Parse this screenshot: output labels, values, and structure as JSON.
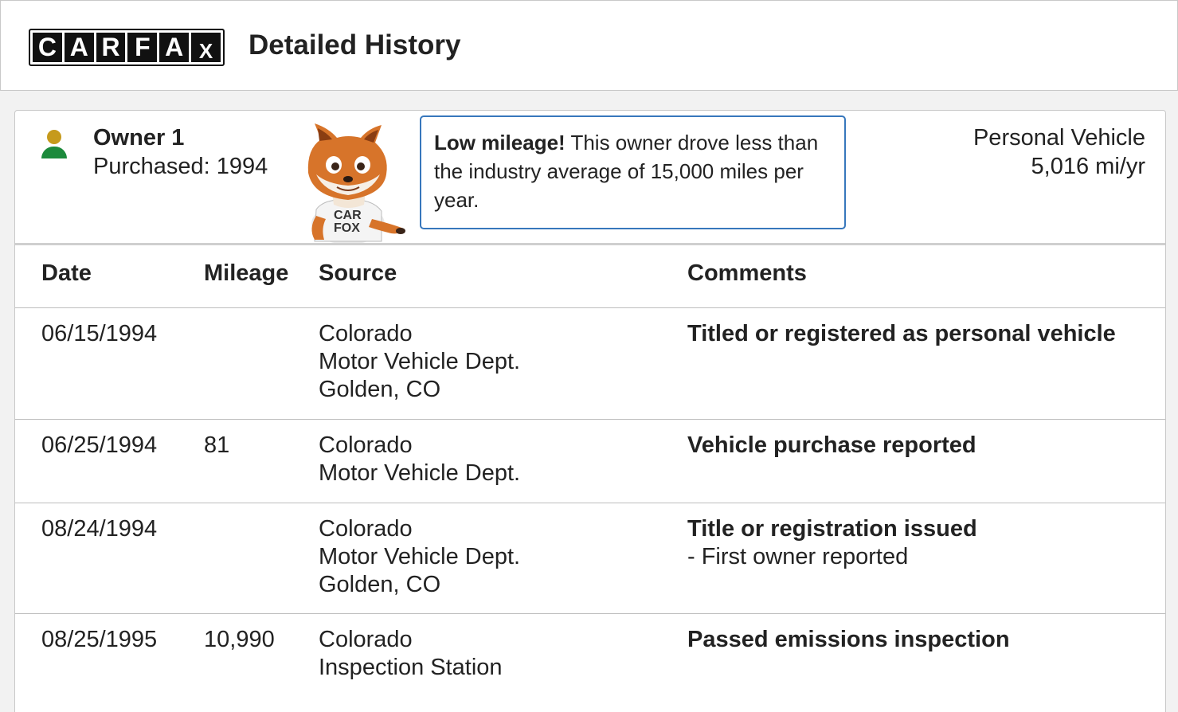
{
  "header": {
    "logo_letters": [
      "C",
      "A",
      "R",
      "F",
      "A",
      "X"
    ],
    "title": "Detailed History"
  },
  "owner": {
    "title": "Owner 1",
    "purchased": "Purchased: 1994",
    "mascot_shirt_text": "CAR FOX",
    "callout_bold": "Low mileage!",
    "callout_text": " This owner drove less than the industry average of 15,000 miles per year.",
    "vehicle_type": "Personal Vehicle",
    "mileage_rate": "5,016 mi/yr"
  },
  "table": {
    "headers": {
      "date": "Date",
      "mileage": "Mileage",
      "source": "Source",
      "comments": "Comments"
    },
    "rows": [
      {
        "date": "06/15/1994",
        "mileage": "",
        "source_1": "Colorado",
        "source_2": "Motor Vehicle Dept.",
        "source_3": "Golden, CO",
        "comment": "Titled or registered as personal vehicle",
        "comment_detail": ""
      },
      {
        "date": "06/25/1994",
        "mileage": "81",
        "source_1": "Colorado",
        "source_2": "Motor Vehicle Dept.",
        "source_3": "",
        "comment": "Vehicle purchase reported",
        "comment_detail": ""
      },
      {
        "date": "08/24/1994",
        "mileage": "",
        "source_1": "Colorado",
        "source_2": "Motor Vehicle Dept.",
        "source_3": "Golden, CO",
        "comment": "Title or registration issued",
        "comment_detail": "- First owner reported"
      },
      {
        "date": "08/25/1995",
        "mileage": "10,990",
        "source_1": "Colorado",
        "source_2": "Inspection Station",
        "source_3": "",
        "comment": "Passed emissions inspection",
        "comment_detail": ""
      }
    ]
  },
  "colors": {
    "callout_border": "#3777bc",
    "person_head": "#c69a1c",
    "person_body": "#1c8a3c"
  }
}
